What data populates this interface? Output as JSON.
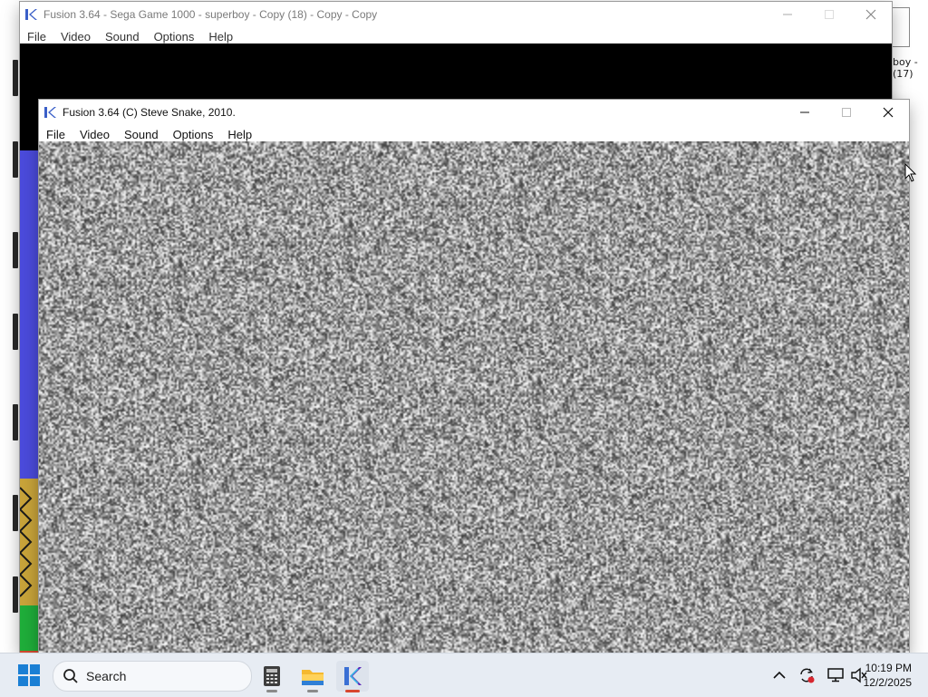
{
  "back_window": {
    "title": "Fusion 3.64 - Sega Game 1000 - superboy - Copy (18) - Copy - Copy",
    "menu": [
      "File",
      "Video",
      "Sound",
      "Options",
      "Help"
    ]
  },
  "front_window": {
    "title": "Fusion 3.64 (C) Steve Snake, 2010.",
    "menu": [
      "File",
      "Video",
      "Sound",
      "Options",
      "Help"
    ]
  },
  "desktop": {
    "right_labels": [
      "boy -",
      "(17)"
    ]
  },
  "taskbar": {
    "search_placeholder": "Search",
    "time": "10:19 PM",
    "date": "12/2/2025"
  },
  "icons": {
    "start": "windows-start-icon",
    "search": "search-icon",
    "app1": "calculator-icon",
    "app2": "file-explorer-icon",
    "app3": "fusion-emulator-icon",
    "tray": [
      "chevron-up-icon",
      "sync-icon",
      "display-icon",
      "speaker-muted-icon"
    ]
  },
  "colors": {
    "accent_red": "#d7462f",
    "noise_gray": "#888888"
  }
}
